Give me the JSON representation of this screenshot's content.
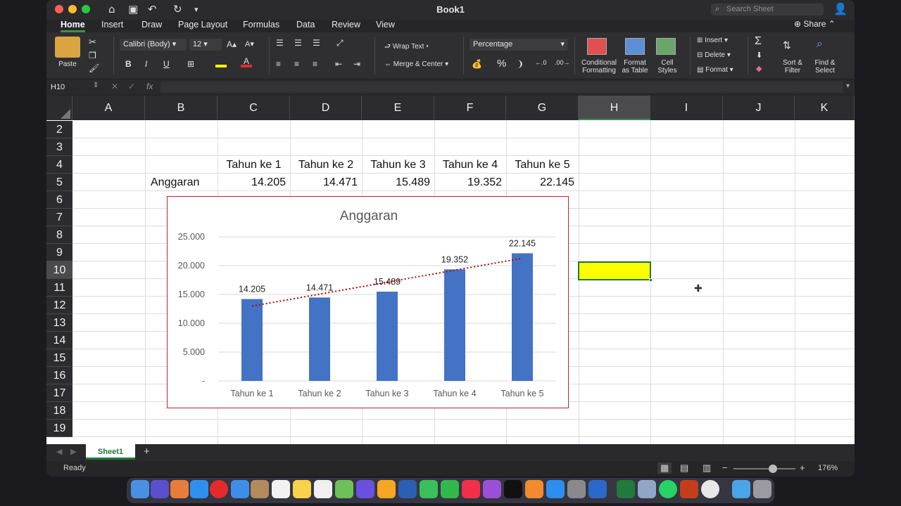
{
  "window": {
    "title": "Book1"
  },
  "search": {
    "placeholder": "Search Sheet"
  },
  "share_label": "Share",
  "tabs": [
    "Home",
    "Insert",
    "Draw",
    "Page Layout",
    "Formulas",
    "Data",
    "Review",
    "View"
  ],
  "ribbon": {
    "paste_label": "Paste",
    "font_name": "Calibri (Body)",
    "font_size": "12",
    "bold": "B",
    "italic": "I",
    "underline": "U",
    "wrap_text": "Wrap Text",
    "merge_center": "Merge & Center",
    "number_format": "Percentage",
    "conditional_formatting_1": "Conditional",
    "conditional_formatting_2": "Formatting",
    "format_table_1": "Format",
    "format_table_2": "as Table",
    "cell_styles_1": "Cell",
    "cell_styles_2": "Styles",
    "insert": "Insert",
    "delete": "Delete",
    "format": "Format",
    "sort_filter_1": "Sort &",
    "sort_filter_2": "Filter",
    "find_select_1": "Find &",
    "find_select_2": "Select",
    "percent_symbol": "%"
  },
  "formula_bar": {
    "name_box": "H10",
    "fx": "fx",
    "value": ""
  },
  "columns": [
    "A",
    "B",
    "C",
    "D",
    "E",
    "F",
    "G",
    "H",
    "I",
    "J",
    "K"
  ],
  "rows": [
    "2",
    "3",
    "4",
    "5",
    "6",
    "7",
    "8",
    "9",
    "10",
    "11",
    "12",
    "13",
    "14",
    "15",
    "16",
    "17",
    "18",
    "19"
  ],
  "cells": {
    "headers": [
      "Tahun ke 1",
      "Tahun ke 2",
      "Tahun ke 3",
      "Tahun ke 4",
      "Tahun ke 5"
    ],
    "row_label": "Anggaran",
    "values": [
      "14.205",
      "14.471",
      "15.489",
      "19.352",
      "22.145"
    ]
  },
  "selected_cell": "H10",
  "chart_data": {
    "type": "bar",
    "title": "Anggaran",
    "categories": [
      "Tahun ke 1",
      "Tahun ke 2",
      "Tahun ke 3",
      "Tahun ke 4",
      "Tahun ke 5"
    ],
    "values": [
      14205,
      14471,
      15489,
      19352,
      22145
    ],
    "data_labels": [
      "14.205",
      "14.471",
      "15.489",
      "19.352",
      "22.145"
    ],
    "y_ticks": [
      "-",
      "5.000",
      "10.000",
      "15.000",
      "20.000",
      "25.000"
    ],
    "ylim": [
      0,
      25000
    ],
    "trendline": "linear",
    "bar_color": "#4472c4",
    "trend_color": "#c00000",
    "grid": true
  },
  "sheets": [
    "Sheet1"
  ],
  "status": {
    "text": "Ready",
    "zoom": "176%"
  }
}
